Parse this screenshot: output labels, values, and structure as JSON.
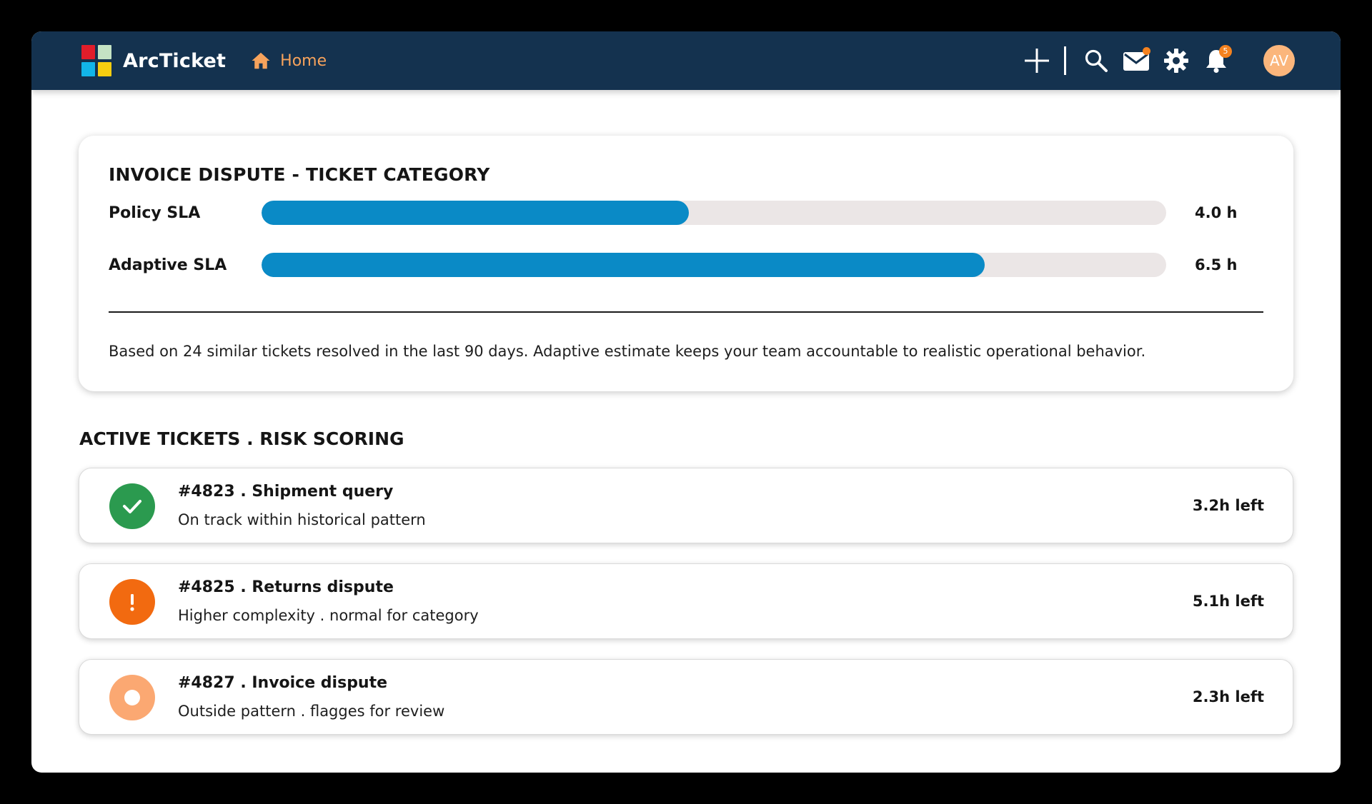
{
  "header": {
    "brand": "ArcTicket",
    "home_label": "Home",
    "notification_count": "5",
    "avatar_initials": "AV",
    "logo_colors": [
      "#e11d2a",
      "#c4e3c4",
      "#12b5e8",
      "#f6cd10"
    ],
    "home_color": "#f7a35c"
  },
  "sla_card": {
    "title": "INVOICE DISPUTE - TICKET CATEGORY",
    "rows": [
      {
        "label": "Policy SLA",
        "value": "4.0 h",
        "fill_fraction": 0.472
      },
      {
        "label": "Adaptive SLA",
        "value": "6.5 h",
        "fill_fraction": 0.799
      }
    ],
    "note": "Based on 24 similar tickets resolved in the last 90 days. Adaptive estimate keeps your team accountable to realistic operational behavior.",
    "bar_color": "#0a8ac6",
    "track_color": "#ebe6e6"
  },
  "tickets_section": {
    "title": "ACTIVE TICKETS . RISK SCORING",
    "tickets": [
      {
        "title": "#4823 . Shipment query",
        "description": "On track within historical pattern",
        "time_left": "3.2h left",
        "status": "on-track",
        "status_icon": "check-icon",
        "status_color": "#2b9a4f"
      },
      {
        "title": "#4825 . Returns dispute",
        "description": "Higher complexity . normal for category",
        "time_left": "5.1h left",
        "status": "warning",
        "status_icon": "exclamation-icon",
        "status_color": "#f26a10"
      },
      {
        "title": "#4827 . Invoice dispute",
        "description": "Outside pattern . flagges for review",
        "time_left": "2.3h left",
        "status": "flagged",
        "status_icon": "ring-icon",
        "status_color": "#fba872"
      }
    ]
  }
}
